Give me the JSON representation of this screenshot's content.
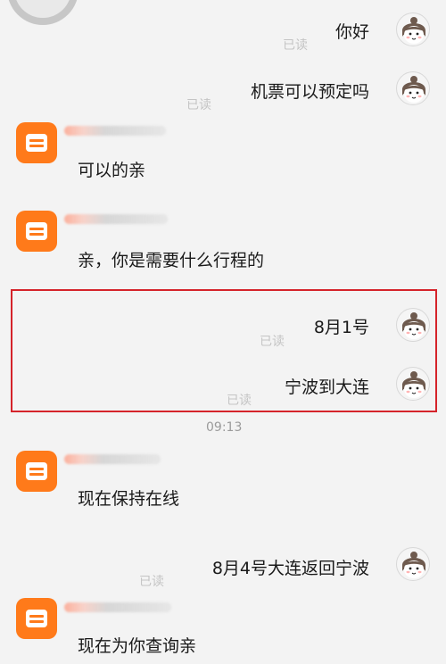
{
  "time_divider": "09:13",
  "read_label": "已读",
  "user_messages": {
    "m1": "你好",
    "m2": "机票可以预定吗",
    "m3": "8月1号",
    "m4": "宁波到大连",
    "m5": "8月4号大连返回宁波"
  },
  "shop_messages": {
    "s1": "可以的亲",
    "s2": "亲，你是需要什么行程的",
    "s3": "现在保持在线",
    "s4": "现在为你查询亲"
  },
  "colors": {
    "background": "#f3f3f3",
    "shop_avatar": "#ff7a1a",
    "highlight_border": "#d5232a",
    "read_text": "#c4c4c4"
  },
  "icons": {
    "user_avatar": "girl-avatar-icon",
    "shop_avatar": "shop-store-icon"
  }
}
